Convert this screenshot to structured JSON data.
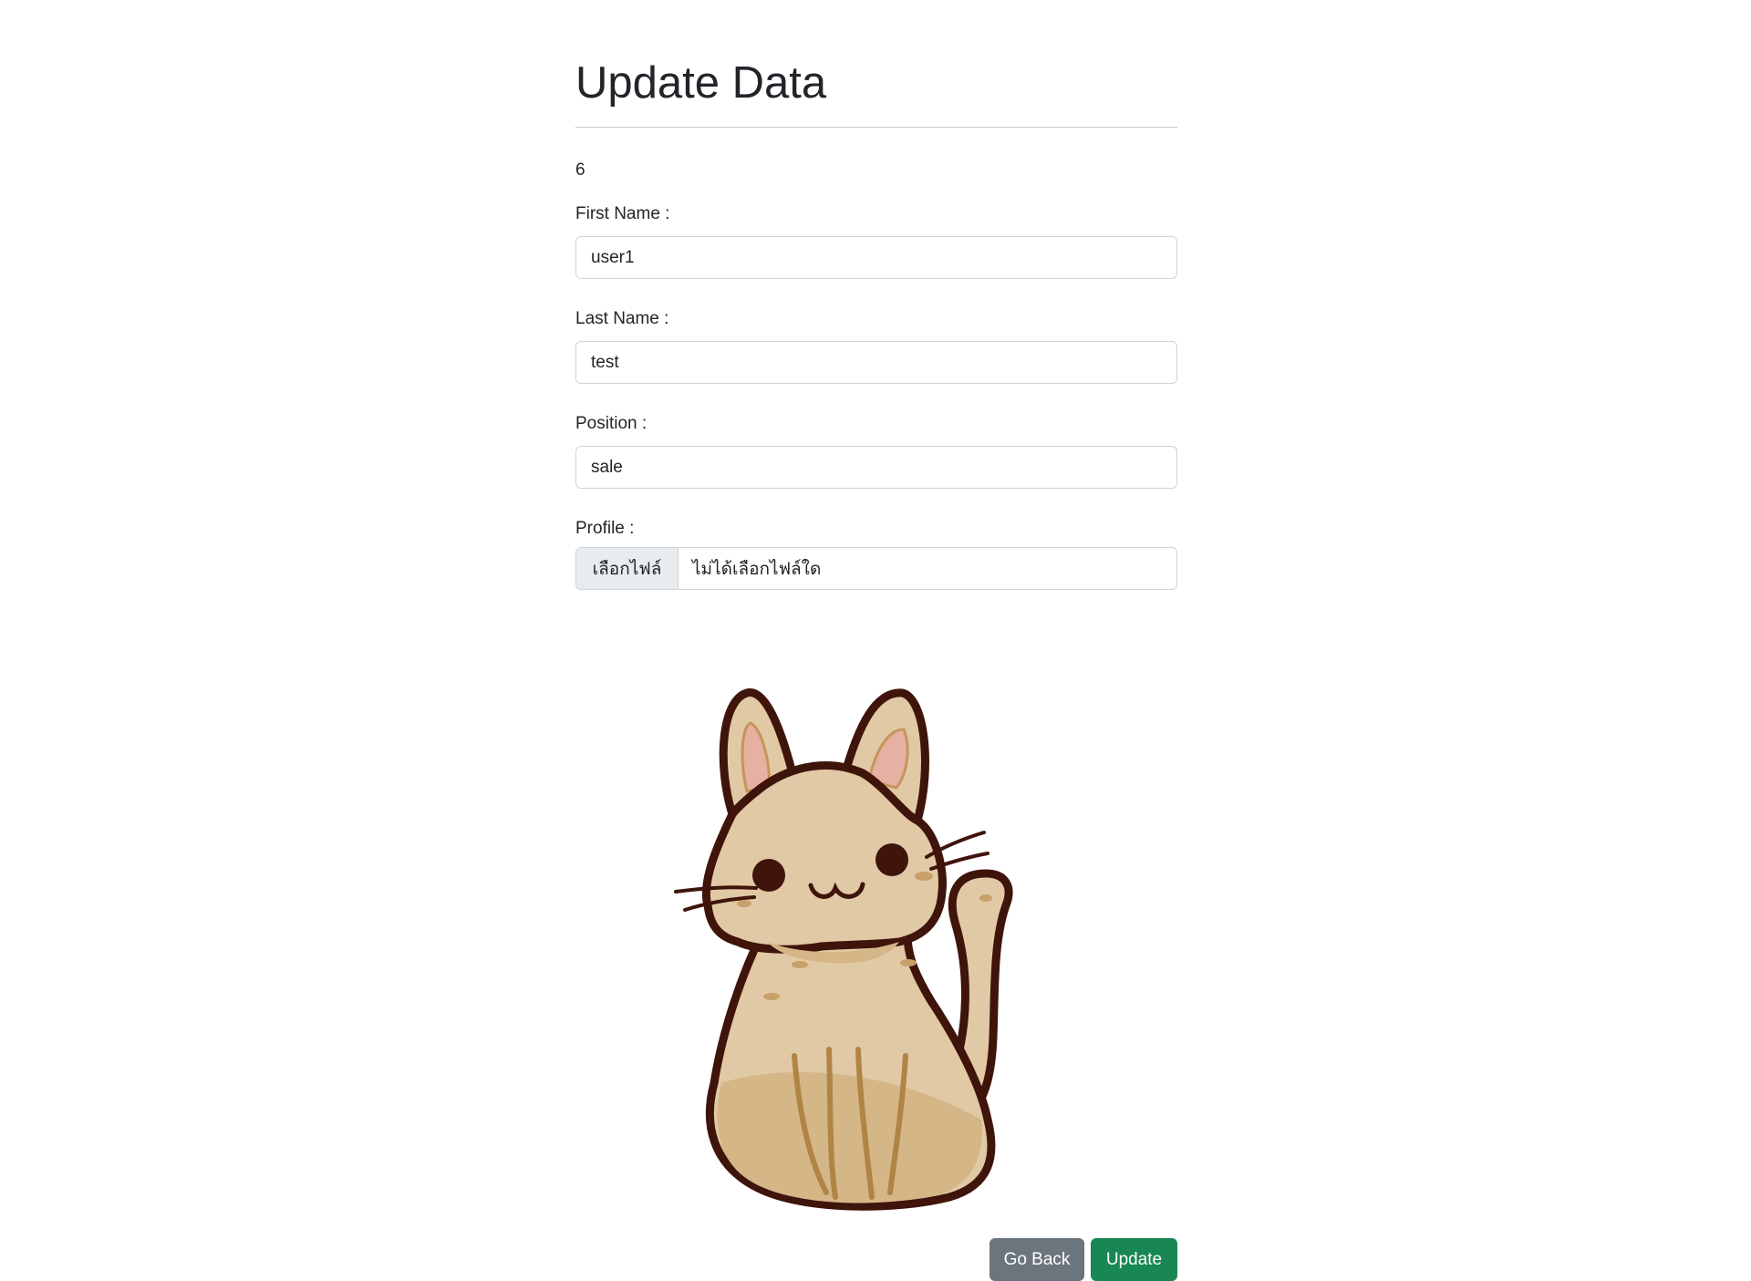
{
  "page": {
    "title": "Update Data",
    "record_id": "6"
  },
  "form": {
    "first_name": {
      "label": "First Name :",
      "value": "user1"
    },
    "last_name": {
      "label": "Last Name :",
      "value": "test"
    },
    "position": {
      "label": "Position :",
      "value": "sale"
    },
    "profile": {
      "label": "Profile :",
      "button_label": "เลือกไฟล์",
      "status_text": "ไม่ได้เลือกไฟล์ใด"
    }
  },
  "profile_image": {
    "subject": "cartoon cat",
    "colors": {
      "fur": "#e1c9a5",
      "fur_shade": "#d4b687",
      "outline": "#3f140a",
      "inner_ear": "#e6b0a3",
      "stripe": "#b08445"
    }
  },
  "actions": {
    "back_label": "Go Back",
    "update_label": "Update"
  },
  "colors": {
    "back_button": "#6c757d",
    "update_button": "#198754",
    "input_border": "#ced4da",
    "file_button_bg": "#e9ecef"
  }
}
